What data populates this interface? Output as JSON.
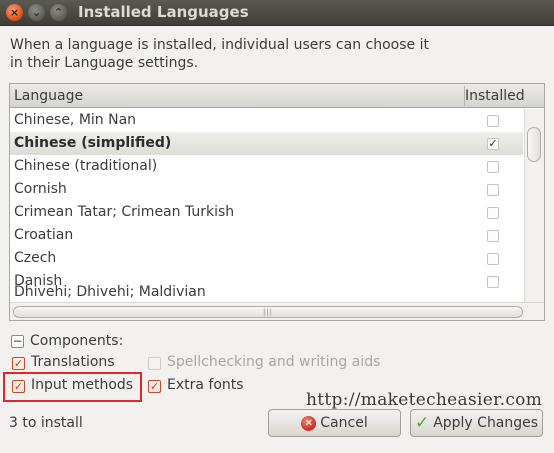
{
  "window": {
    "title": "Installed Languages",
    "buttons": {
      "close": "×",
      "minimize": "⌄",
      "maximize": "⌃"
    }
  },
  "intro_text": "When a language is installed, individual users can choose it in their Language settings.",
  "list": {
    "headers": {
      "language": "Language",
      "installed": "Installed"
    },
    "rows": [
      {
        "language": "Chinese, Min Nan",
        "installed": false
      },
      {
        "language": "Chinese (simplified)",
        "installed": true
      },
      {
        "language": "Chinese (traditional)",
        "installed": false
      },
      {
        "language": "Cornish",
        "installed": false
      },
      {
        "language": "Crimean Tatar; Crimean Turkish",
        "installed": false
      },
      {
        "language": "Croatian",
        "installed": false
      },
      {
        "language": "Czech",
        "installed": false
      },
      {
        "language": "Danish",
        "installed": false
      },
      {
        "language": "Dhivehi; Dhivehi; Maldivian",
        "installed": false
      }
    ],
    "selected_row": "Chinese (simplified)",
    "hscroll_grip": "|||"
  },
  "components": {
    "expander_glyph": "−",
    "label": "Components:",
    "translations": {
      "label": "Translations",
      "checked": true,
      "enabled": true
    },
    "spellchecking": {
      "label": "Spellchecking and writing aids",
      "checked": false,
      "enabled": false
    },
    "input_methods": {
      "label": "Input methods",
      "checked": true,
      "enabled": true
    },
    "extra_fonts": {
      "label": "Extra fonts",
      "checked": true,
      "enabled": true
    }
  },
  "watermark": "http://maketecheasier.com",
  "status": "3 to install",
  "buttons": {
    "cancel": "Cancel",
    "apply": "Apply Changes"
  },
  "check_glyph": "✓",
  "colors": {
    "highlight_box": "#e4262b",
    "titlebar": "#3d3c37",
    "checkbox_accent": "#c23b1a"
  }
}
